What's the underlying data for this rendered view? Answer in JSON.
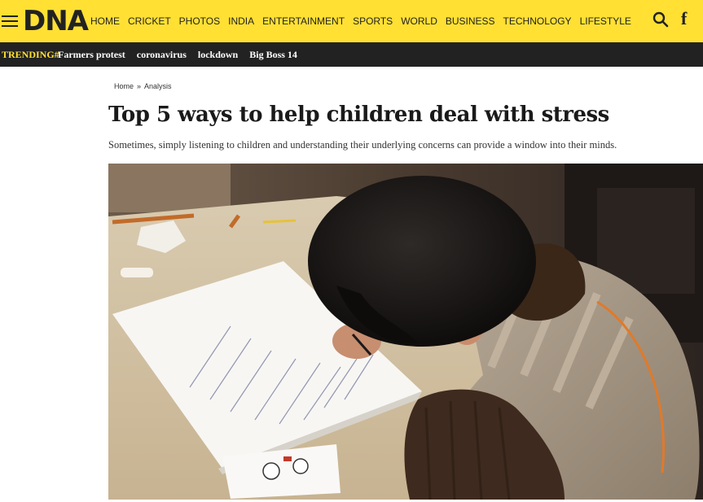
{
  "header": {
    "logo": "DNA",
    "nav": [
      "HOME",
      "CRICKET",
      "PHOTOS",
      "INDIA",
      "ENTERTAINMENT",
      "SPORTS",
      "WORLD",
      "BUSINESS",
      "TECHNOLOGY",
      "LIFESTYLE"
    ],
    "icons": [
      "menu-icon",
      "search-icon",
      "facebook-icon"
    ],
    "brand_color": "#ffe033"
  },
  "trending": {
    "label": "TRENDING#",
    "items": [
      "Farmers protest",
      "coronavirus",
      "lockdown",
      "Big Boss 14"
    ]
  },
  "breadcrumb": {
    "home": "Home",
    "separator": "»",
    "section": "Analysis"
  },
  "article": {
    "title": "Top 5 ways to help children deal with stress",
    "subtitle": "Sometimes, simply listening to children and understanding their underlying concerns can provide a window into their minds."
  }
}
